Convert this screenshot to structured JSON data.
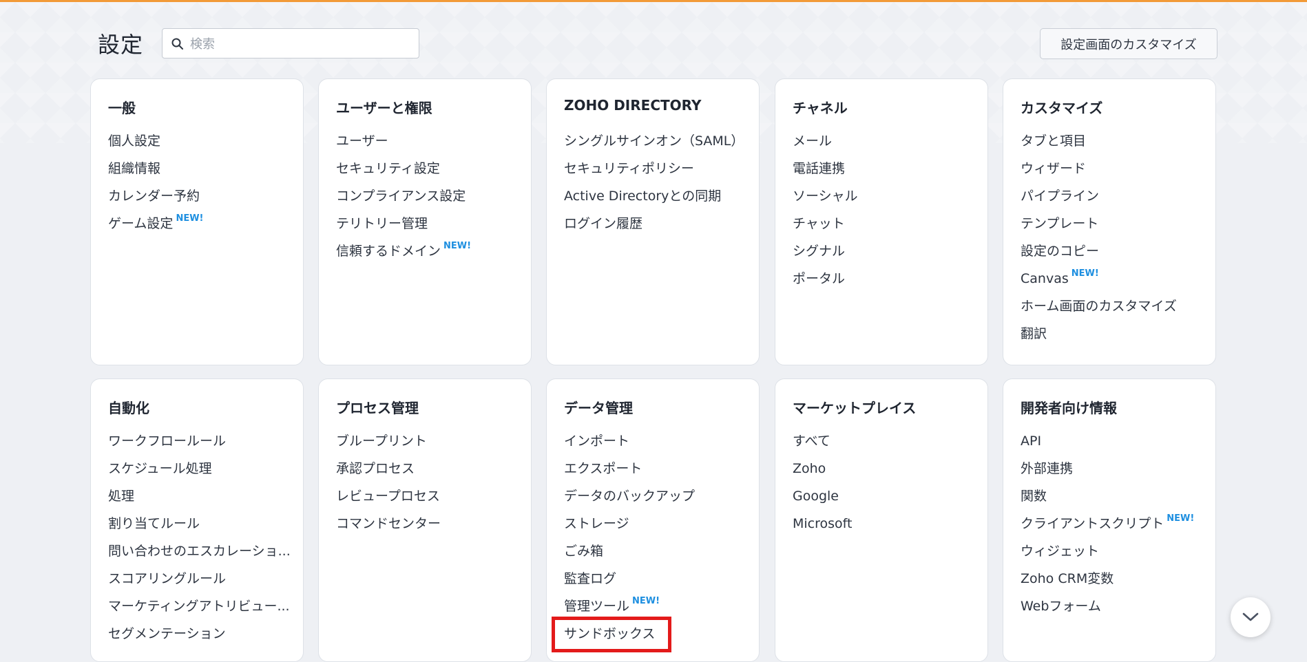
{
  "header": {
    "title": "設定",
    "search_placeholder": "検索",
    "customize_label": "設定画面のカスタマイズ"
  },
  "new_badge": "NEW!",
  "cards": [
    {
      "title": "一般",
      "items": [
        {
          "label": "個人設定"
        },
        {
          "label": "組織情報"
        },
        {
          "label": "カレンダー予約"
        },
        {
          "label": "ゲーム設定",
          "badge": "NEW!"
        }
      ]
    },
    {
      "title": "ユーザーと権限",
      "items": [
        {
          "label": "ユーザー"
        },
        {
          "label": "セキュリティ設定"
        },
        {
          "label": "コンプライアンス設定"
        },
        {
          "label": "テリトリー管理"
        },
        {
          "label": "信頼するドメイン",
          "badge": "NEW!"
        }
      ]
    },
    {
      "title": "ZOHO DIRECTORY",
      "items": [
        {
          "label": "シングルサインオン（SAML）"
        },
        {
          "label": "セキュリティポリシー"
        },
        {
          "label": "Active Directoryとの同期"
        },
        {
          "label": "ログイン履歴"
        }
      ]
    },
    {
      "title": "チャネル",
      "items": [
        {
          "label": "メール"
        },
        {
          "label": "電話連携"
        },
        {
          "label": "ソーシャル"
        },
        {
          "label": "チャット"
        },
        {
          "label": "シグナル"
        },
        {
          "label": "ポータル"
        }
      ]
    },
    {
      "title": "カスタマイズ",
      "items": [
        {
          "label": "タブと項目"
        },
        {
          "label": "ウィザード"
        },
        {
          "label": "パイプライン"
        },
        {
          "label": "テンプレート"
        },
        {
          "label": "設定のコピー"
        },
        {
          "label": "Canvas",
          "badge": "NEW!"
        },
        {
          "label": "ホーム画面のカスタマイズ"
        },
        {
          "label": "翻訳"
        }
      ]
    },
    {
      "title": "自動化",
      "items": [
        {
          "label": "ワークフロールール"
        },
        {
          "label": "スケジュール処理"
        },
        {
          "label": "処理"
        },
        {
          "label": "割り当てルール"
        },
        {
          "label": "問い合わせのエスカレーショ..."
        },
        {
          "label": "スコアリングルール"
        },
        {
          "label": "マーケティングアトリビュー..."
        },
        {
          "label": "セグメンテーション"
        }
      ]
    },
    {
      "title": "プロセス管理",
      "items": [
        {
          "label": "ブループリント"
        },
        {
          "label": "承認プロセス"
        },
        {
          "label": "レビュープロセス"
        },
        {
          "label": "コマンドセンター"
        }
      ]
    },
    {
      "title": "データ管理",
      "items": [
        {
          "label": "インポート"
        },
        {
          "label": "エクスポート"
        },
        {
          "label": "データのバックアップ"
        },
        {
          "label": "ストレージ"
        },
        {
          "label": "ごみ箱"
        },
        {
          "label": "監査ログ"
        },
        {
          "label": "管理ツール",
          "badge": "NEW!"
        },
        {
          "label": "サンドボックス",
          "highlighted": true
        }
      ]
    },
    {
      "title": "マーケットプレイス",
      "items": [
        {
          "label": "すべて"
        },
        {
          "label": "Zoho"
        },
        {
          "label": "Google"
        },
        {
          "label": "Microsoft"
        }
      ]
    },
    {
      "title": "開発者向け情報",
      "items": [
        {
          "label": "API"
        },
        {
          "label": "外部連携"
        },
        {
          "label": "関数"
        },
        {
          "label": "クライアントスクリプト",
          "badge": "NEW!"
        },
        {
          "label": "ウィジェット"
        },
        {
          "label": "Zoho CRM変数"
        },
        {
          "label": "Webフォーム"
        }
      ]
    }
  ],
  "colors": {
    "accent_bar": "#f29a38",
    "new_badge": "#1e8fe0",
    "highlight_box": "#e31a1a"
  }
}
